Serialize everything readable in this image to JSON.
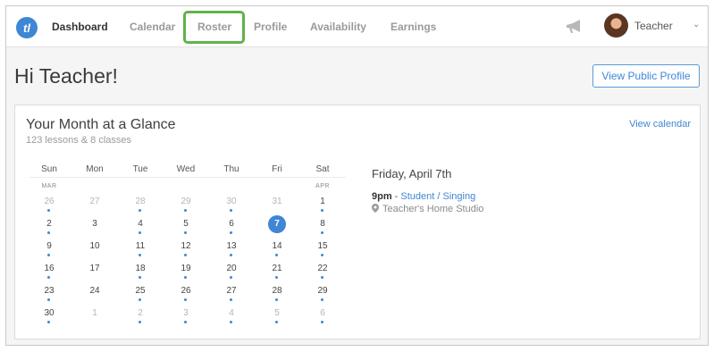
{
  "app": {
    "logo": "tl",
    "accent": "#3f86d4",
    "highlight": "#5fb34a"
  },
  "nav": {
    "items": [
      {
        "label": "Dashboard",
        "active": true
      },
      {
        "label": "Calendar",
        "active": false
      },
      {
        "label": "Roster",
        "active": false,
        "highlighted": true
      },
      {
        "label": "Profile",
        "active": false
      },
      {
        "label": "Availability",
        "active": false
      },
      {
        "label": "Earnings",
        "active": false
      }
    ],
    "user_name": "Teacher",
    "megaphone_icon": "megaphone-icon",
    "dropdown_icon": "chevron-down-icon"
  },
  "greeting": "Hi Teacher!",
  "view_public_profile": "View Public Profile",
  "month": {
    "title": "Your Month at a Glance",
    "subtitle": "123 lessons & 8 classes",
    "view_calendar": "View calendar",
    "weekdays": [
      "Sun",
      "Mon",
      "Tue",
      "Wed",
      "Thu",
      "Fri",
      "Sat"
    ],
    "month_labels": {
      "start": "MAR",
      "end": "APR"
    },
    "weeks": [
      [
        {
          "d": "26",
          "m": true,
          "dot": true
        },
        {
          "d": "27",
          "m": true,
          "dot": false
        },
        {
          "d": "28",
          "m": true,
          "dot": true
        },
        {
          "d": "29",
          "m": true,
          "dot": true
        },
        {
          "d": "30",
          "m": true,
          "dot": true
        },
        {
          "d": "31",
          "m": true,
          "dot": false
        },
        {
          "d": "1",
          "m": false,
          "dot": true
        }
      ],
      [
        {
          "d": "2",
          "m": false,
          "dot": true
        },
        {
          "d": "3",
          "m": false,
          "dot": false
        },
        {
          "d": "4",
          "m": false,
          "dot": true
        },
        {
          "d": "5",
          "m": false,
          "dot": true
        },
        {
          "d": "6",
          "m": false,
          "dot": true
        },
        {
          "d": "7",
          "m": false,
          "dot": false,
          "sel": true
        },
        {
          "d": "8",
          "m": false,
          "dot": true
        }
      ],
      [
        {
          "d": "9",
          "m": false,
          "dot": true
        },
        {
          "d": "10",
          "m": false,
          "dot": false
        },
        {
          "d": "11",
          "m": false,
          "dot": true
        },
        {
          "d": "12",
          "m": false,
          "dot": true
        },
        {
          "d": "13",
          "m": false,
          "dot": true
        },
        {
          "d": "14",
          "m": false,
          "dot": true
        },
        {
          "d": "15",
          "m": false,
          "dot": true
        }
      ],
      [
        {
          "d": "16",
          "m": false,
          "dot": true
        },
        {
          "d": "17",
          "m": false,
          "dot": false
        },
        {
          "d": "18",
          "m": false,
          "dot": true
        },
        {
          "d": "19",
          "m": false,
          "dot": true
        },
        {
          "d": "20",
          "m": false,
          "dot": true
        },
        {
          "d": "21",
          "m": false,
          "dot": true
        },
        {
          "d": "22",
          "m": false,
          "dot": true
        }
      ],
      [
        {
          "d": "23",
          "m": false,
          "dot": true
        },
        {
          "d": "24",
          "m": false,
          "dot": false
        },
        {
          "d": "25",
          "m": false,
          "dot": true
        },
        {
          "d": "26",
          "m": false,
          "dot": true
        },
        {
          "d": "27",
          "m": false,
          "dot": true
        },
        {
          "d": "28",
          "m": false,
          "dot": true
        },
        {
          "d": "29",
          "m": false,
          "dot": true
        }
      ],
      [
        {
          "d": "30",
          "m": false,
          "dot": true
        },
        {
          "d": "1",
          "m": true,
          "dot": false
        },
        {
          "d": "2",
          "m": true,
          "dot": true
        },
        {
          "d": "3",
          "m": true,
          "dot": true
        },
        {
          "d": "4",
          "m": true,
          "dot": true
        },
        {
          "d": "5",
          "m": true,
          "dot": true
        },
        {
          "d": "6",
          "m": true,
          "dot": true
        }
      ]
    ],
    "selected_day_heading": "Friday, April 7th",
    "event": {
      "time": "9pm",
      "separator": " - ",
      "student": "Student / Singing",
      "location": "Teacher's Home Studio",
      "location_icon": "map-pin-icon"
    }
  }
}
